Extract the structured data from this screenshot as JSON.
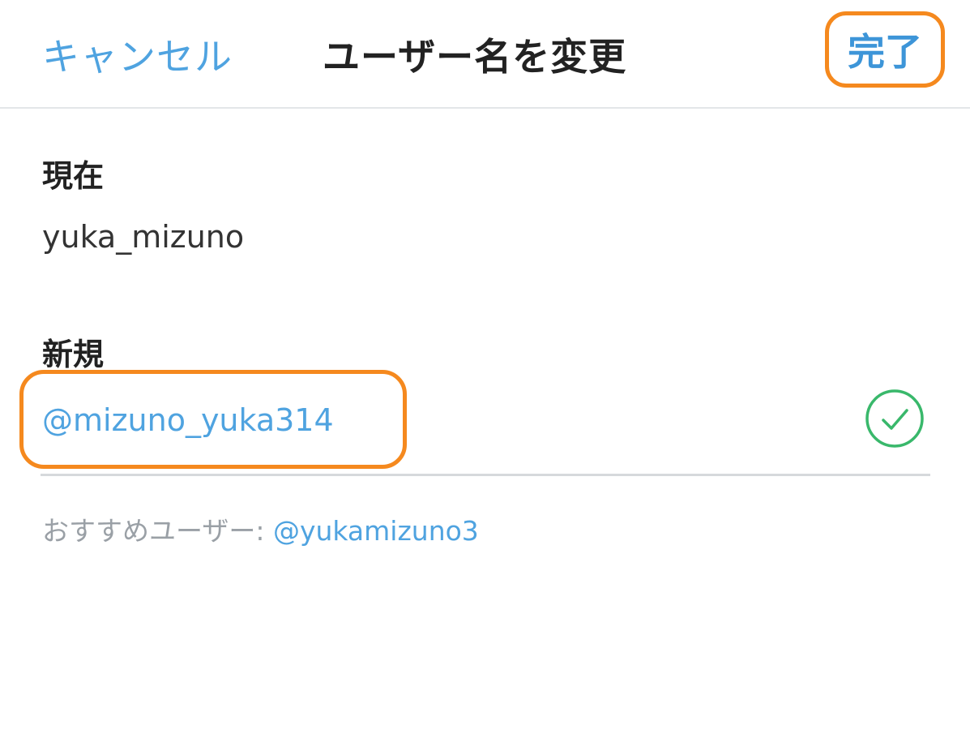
{
  "navbar": {
    "cancel_label": "キャンセル",
    "title": "ユーザー名を変更",
    "done_label": "完了"
  },
  "current": {
    "label": "現在",
    "value": "yuka_mizuno"
  },
  "new": {
    "label": "新規",
    "value": "@mizuno_yuka314",
    "status_icon": "check-circle-icon"
  },
  "suggestion": {
    "prefix": "おすすめユーザー: ",
    "username": "@yukamizuno3"
  },
  "colors": {
    "accent": "#4fa3e0",
    "highlight": "#f5891e",
    "valid": "#39b86b",
    "text": "#222222",
    "muted": "#9aa0a6",
    "divider": "#d6d9dc"
  }
}
